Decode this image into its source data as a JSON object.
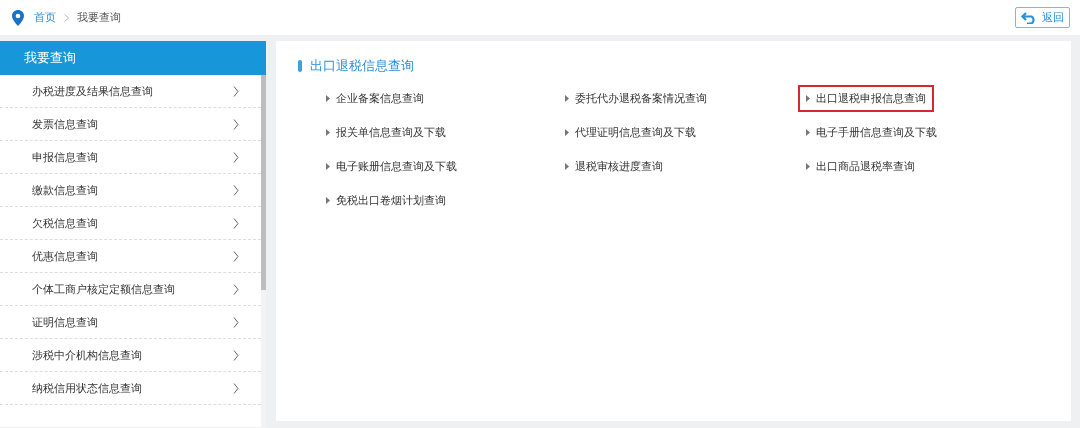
{
  "breadcrumb": [
    {
      "label": "首页",
      "link": true
    },
    {
      "label": "我要查询",
      "link": false
    }
  ],
  "back_button": {
    "label": "返回"
  },
  "sidebar": {
    "title": "我要查询",
    "items": [
      {
        "label": "办税进度及结果信息查询"
      },
      {
        "label": "发票信息查询"
      },
      {
        "label": "申报信息查询"
      },
      {
        "label": "缴款信息查询"
      },
      {
        "label": "欠税信息查询"
      },
      {
        "label": "优惠信息查询"
      },
      {
        "label": "个体工商户核定定额信息查询"
      },
      {
        "label": "证明信息查询"
      },
      {
        "label": "涉税中介机构信息查询"
      },
      {
        "label": "纳税信用状态信息查询"
      }
    ]
  },
  "section": {
    "title": "出口退税信息查询",
    "links": [
      {
        "label": "企业备案信息查询",
        "highlighted": false
      },
      {
        "label": "委托代办退税备案情况查询",
        "highlighted": false
      },
      {
        "label": "出口退税申报信息查询",
        "highlighted": true
      },
      {
        "label": "报关单信息查询及下载",
        "highlighted": false
      },
      {
        "label": "代理证明信息查询及下载",
        "highlighted": false
      },
      {
        "label": "电子手册信息查询及下载",
        "highlighted": false
      },
      {
        "label": "电子账册信息查询及下载",
        "highlighted": false
      },
      {
        "label": "退税审核进度查询",
        "highlighted": false
      },
      {
        "label": "出口商品退税率查询",
        "highlighted": false
      },
      {
        "label": "免税出口卷烟计划查询",
        "highlighted": false
      }
    ]
  }
}
